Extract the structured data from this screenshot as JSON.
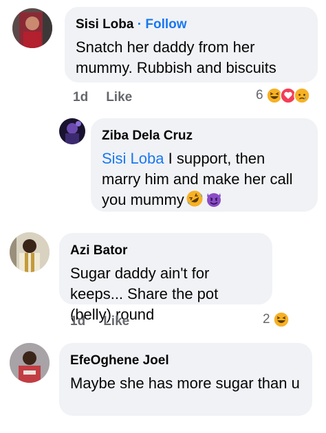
{
  "comments": [
    {
      "author": "Sisi Loba",
      "separator": "·",
      "follow_label": "Follow",
      "text": "Snatch her daddy from her mummy. Rubbish and biscuits",
      "time": "1d",
      "like_label": "Like",
      "reaction_count": "6",
      "reaction_icons": [
        "haha-icon",
        "love-icon",
        "sad-icon"
      ]
    },
    {
      "author": "Ziba Dela Cruz",
      "mention": "Sisi Loba",
      "text": " I support, then marry him and make her call you mummy",
      "text_emojis": [
        "rolling-laughing-emoji",
        "smiling-devil-emoji"
      ]
    },
    {
      "author": "Azi Bator",
      "text": "Sugar daddy ain't for keeps... Share the pot (belly) round",
      "time": "1d",
      "like_label": "Like",
      "reaction_count": "2",
      "reaction_icons": [
        "haha-icon"
      ]
    },
    {
      "author": "EfeOghene Joel",
      "text": "Maybe she has more sugar than u"
    }
  ],
  "colors": {
    "bubble": "#f0f2f5",
    "link": "#1877f2",
    "meta": "#65676b",
    "text": "#050505"
  }
}
